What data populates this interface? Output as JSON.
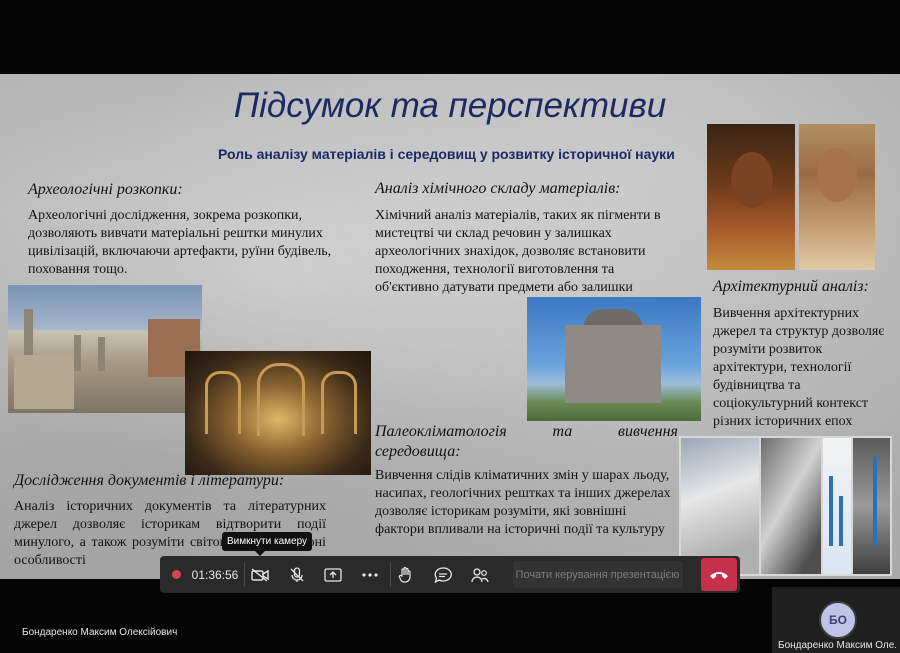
{
  "slide": {
    "title": "Підсумок та перспективи",
    "subtitle": "Роль аналізу матеріалів і середовищ у розвитку історичної науки",
    "sections": [
      {
        "heading": "Археологічні розкопки:",
        "text": "Археологічні дослідження, зокрема розкопки, дозволяють вивчати матеріальні рештки минулих цивілізацій, включаючи артефакти, руїни будівель, поховання тощо."
      },
      {
        "heading": "Аналіз хімічного складу матеріалів:",
        "text": "Хімічний аналіз матеріалів, таких як пігменти в мистецтві чи склад речовин у залишках археологічних знахідок, дозволяє встановити походження, технології виготовлення та об'єктивно датувати предмети або залишки"
      },
      {
        "heading": "Архітектурний аналіз:",
        "text": "Вивчення архітектурних джерел та структур дозволяє розуміти розвиток архітектури, технології будівництва та соціокультурний контекст різних історичних епох"
      },
      {
        "heading": "Палеокліматологія та вивчення середовища:",
        "text": "Вивчення слідів кліматичних змін у шарах льоду, насипах, геологічних рештках та інших джерелах дозволяє історикам розуміти, які зовнішні фактори впливали на історичні події та культуру"
      },
      {
        "heading": "Дослідження документів і літератури:",
        "text": "Аналіз історичних документів та літературних джерел дозволяє історикам відтворити події минулого, а також розуміти світогляд та культурні особливості"
      }
    ]
  },
  "toolbar": {
    "timer": "01:36:56",
    "present_placeholder": "Почати керування презентацією",
    "tooltip": "Вимкнути камеру"
  },
  "presenter_name": "Бондаренко Максим Олексійович",
  "self_tile": {
    "initials": "БО",
    "name": "Бондаренко Максим Оле..."
  },
  "icons": [
    "record-icon",
    "camera-off-icon",
    "mic-off-icon",
    "share-screen-icon",
    "more-icon",
    "raise-hand-icon",
    "chat-icon",
    "people-icon",
    "hang-up-icon"
  ],
  "colors": {
    "title": "#1b2a63",
    "hangup": "#c4314b",
    "record": "#d24353"
  }
}
